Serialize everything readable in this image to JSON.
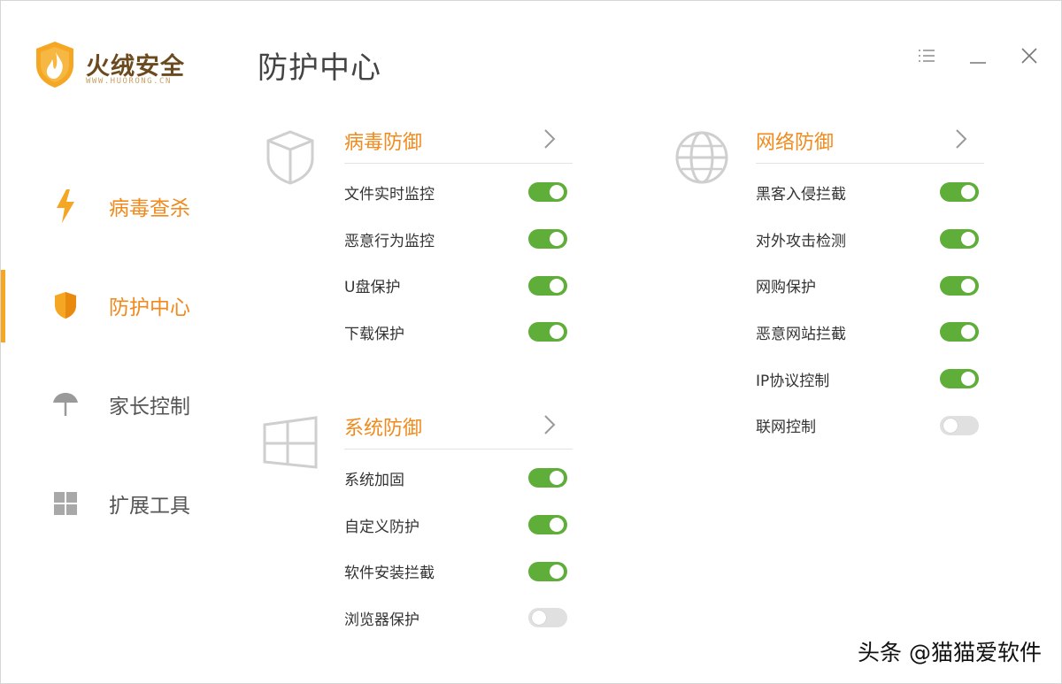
{
  "brand": {
    "name": "火绒安全",
    "url": "WWW.HUORONG.CN",
    "accent": "#f5a623"
  },
  "page_title": "防护中心",
  "window_controls": {
    "menu_icon": "menu-icon",
    "minimize_icon": "minimize-icon",
    "close_icon": "close-icon"
  },
  "sidebar": {
    "items": [
      {
        "label": "病毒查杀",
        "icon": "lightning-icon"
      },
      {
        "label": "防护中心",
        "icon": "shield-icon"
      },
      {
        "label": "家长控制",
        "icon": "umbrella-icon"
      },
      {
        "label": "扩展工具",
        "icon": "grid-icon"
      }
    ]
  },
  "sections": {
    "virus": {
      "title": "病毒防御",
      "icon": "shield-outline-icon",
      "items": [
        {
          "label": "文件实时监控",
          "on": true
        },
        {
          "label": "恶意行为监控",
          "on": true
        },
        {
          "label": "U盘保护",
          "on": true
        },
        {
          "label": "下载保护",
          "on": true
        }
      ]
    },
    "system": {
      "title": "系统防御",
      "icon": "windows-icon",
      "items": [
        {
          "label": "系统加固",
          "on": true
        },
        {
          "label": "自定义防护",
          "on": true
        },
        {
          "label": "软件安装拦截",
          "on": true
        },
        {
          "label": "浏览器保护",
          "on": false
        }
      ]
    },
    "network": {
      "title": "网络防御",
      "icon": "globe-icon",
      "items": [
        {
          "label": "黑客入侵拦截",
          "on": true
        },
        {
          "label": "对外攻击检测",
          "on": true
        },
        {
          "label": "网购保护",
          "on": true
        },
        {
          "label": "恶意网站拦截",
          "on": true
        },
        {
          "label": "IP协议控制",
          "on": true
        },
        {
          "label": "联网控制",
          "on": false
        }
      ]
    }
  },
  "colors": {
    "toggle_on": "#5fae3a",
    "toggle_off": "#e0e0e0",
    "accent": "#f08a1c"
  },
  "watermark": "头条 @猫猫爱软件"
}
